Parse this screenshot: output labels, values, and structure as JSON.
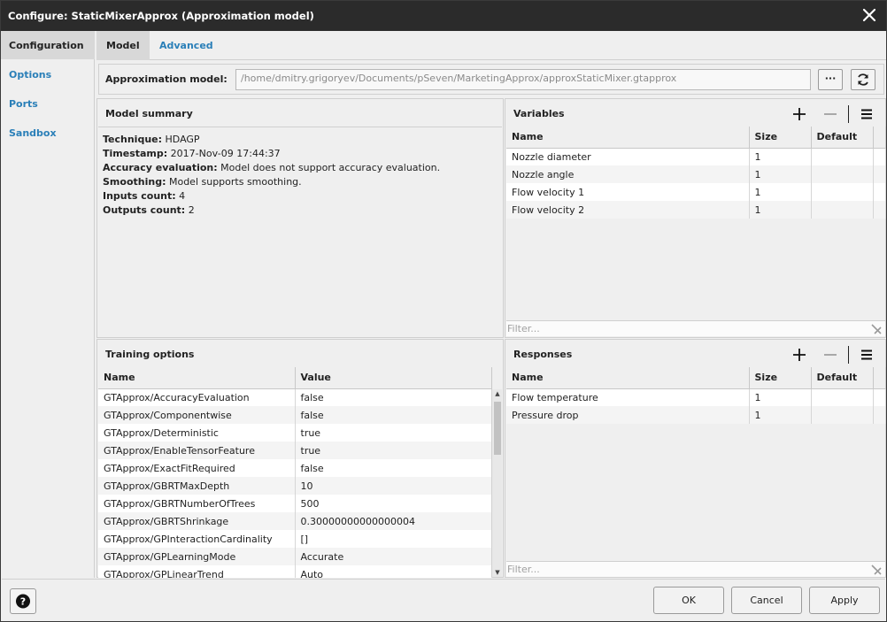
{
  "window": {
    "title": "Configure: StaticMixerApprox (Approximation model)",
    "close_icon": "close-icon"
  },
  "nav": {
    "items": [
      {
        "label": "Configuration",
        "active": true
      },
      {
        "label": "Options",
        "active": false
      },
      {
        "label": "Ports",
        "active": false
      },
      {
        "label": "Sandbox",
        "active": false
      }
    ]
  },
  "tabs": [
    {
      "label": "Model",
      "active": true
    },
    {
      "label": "Advanced",
      "active": false
    }
  ],
  "model_bar": {
    "label": "Approximation model:",
    "path": "/home/dmitry.grigoryev/Documents/pSeven/MarketingApprox/approxStaticMixer.gtapprox",
    "browse_label": "···",
    "refresh_icon": "refresh-icon"
  },
  "summary": {
    "title": "Model summary",
    "lines": [
      {
        "key": "Technique:",
        "value": "HDAGP"
      },
      {
        "key": "Timestamp:",
        "value": "2017-Nov-09 17:44:37"
      },
      {
        "key": "Accuracy evaluation:",
        "value": "Model does not support accuracy evaluation."
      },
      {
        "key": "Smoothing:",
        "value": "Model supports smoothing."
      },
      {
        "key": "Inputs count:",
        "value": "4"
      },
      {
        "key": "Outputs count:",
        "value": "2"
      }
    ]
  },
  "variables": {
    "title": "Variables",
    "columns": [
      "Name",
      "Size",
      "Default"
    ],
    "rows": [
      {
        "name": "Nozzle diameter",
        "size": "1",
        "default": ""
      },
      {
        "name": "Nozzle angle",
        "size": "1",
        "default": ""
      },
      {
        "name": "Flow velocity 1",
        "size": "1",
        "default": ""
      },
      {
        "name": "Flow velocity 2",
        "size": "1",
        "default": ""
      }
    ],
    "filter_placeholder": "Filter..."
  },
  "training": {
    "title": "Training options",
    "columns": [
      "Name",
      "Value"
    ],
    "rows": [
      {
        "name": "GTApprox/AccuracyEvaluation",
        "value": "false"
      },
      {
        "name": "GTApprox/Componentwise",
        "value": "false"
      },
      {
        "name": "GTApprox/Deterministic",
        "value": "true"
      },
      {
        "name": "GTApprox/EnableTensorFeature",
        "value": "true"
      },
      {
        "name": "GTApprox/ExactFitRequired",
        "value": "false"
      },
      {
        "name": "GTApprox/GBRTMaxDepth",
        "value": "10"
      },
      {
        "name": "GTApprox/GBRTNumberOfTrees",
        "value": "500"
      },
      {
        "name": "GTApprox/GBRTShrinkage",
        "value": "0.30000000000000004"
      },
      {
        "name": "GTApprox/GPInteractionCardinality",
        "value": "[]"
      },
      {
        "name": "GTApprox/GPLearningMode",
        "value": "Accurate"
      },
      {
        "name": "GTApprox/GPLinearTrend",
        "value": "Auto"
      }
    ]
  },
  "responses": {
    "title": "Responses",
    "columns": [
      "Name",
      "Size",
      "Default"
    ],
    "rows": [
      {
        "name": "Flow temperature",
        "size": "1",
        "default": ""
      },
      {
        "name": "Pressure drop",
        "size": "1",
        "default": ""
      }
    ],
    "filter_placeholder": "Filter..."
  },
  "footer": {
    "help_label": "?",
    "ok_label": "OK",
    "cancel_label": "Cancel",
    "apply_label": "Apply"
  }
}
